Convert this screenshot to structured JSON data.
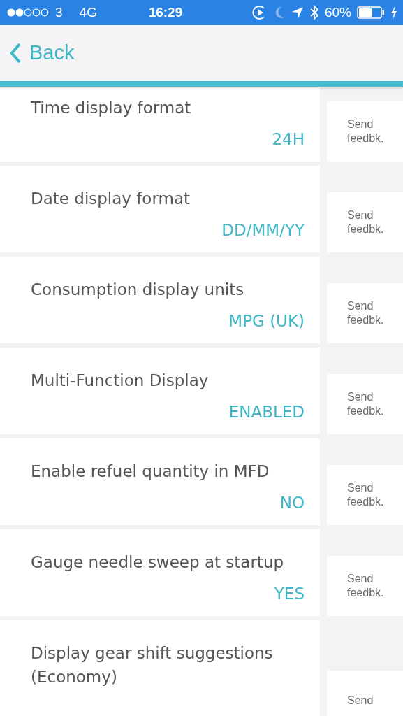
{
  "status_bar": {
    "carrier": "3",
    "network": "4G",
    "time": "16:29",
    "battery": "60%"
  },
  "nav": {
    "back_label": "Back"
  },
  "settings": [
    {
      "title": "Time display format",
      "value": "24H",
      "feedback": "Send feedbk."
    },
    {
      "title": "Date display format",
      "value": "DD/MM/YY",
      "feedback": "Send feedbk."
    },
    {
      "title": "Consumption display units",
      "value": "MPG (UK)",
      "feedback": "Send feedbk."
    },
    {
      "title": "Multi-Function Display",
      "value": "ENABLED",
      "feedback": "Send feedbk."
    },
    {
      "title": "Enable refuel quantity in MFD",
      "value": "NO",
      "feedback": "Send feedbk."
    },
    {
      "title": "Gauge needle sweep at startup",
      "value": "YES",
      "feedback": "Send feedbk."
    },
    {
      "title": "Display gear shift suggestions (Economy)",
      "feedback": "Send"
    }
  ]
}
